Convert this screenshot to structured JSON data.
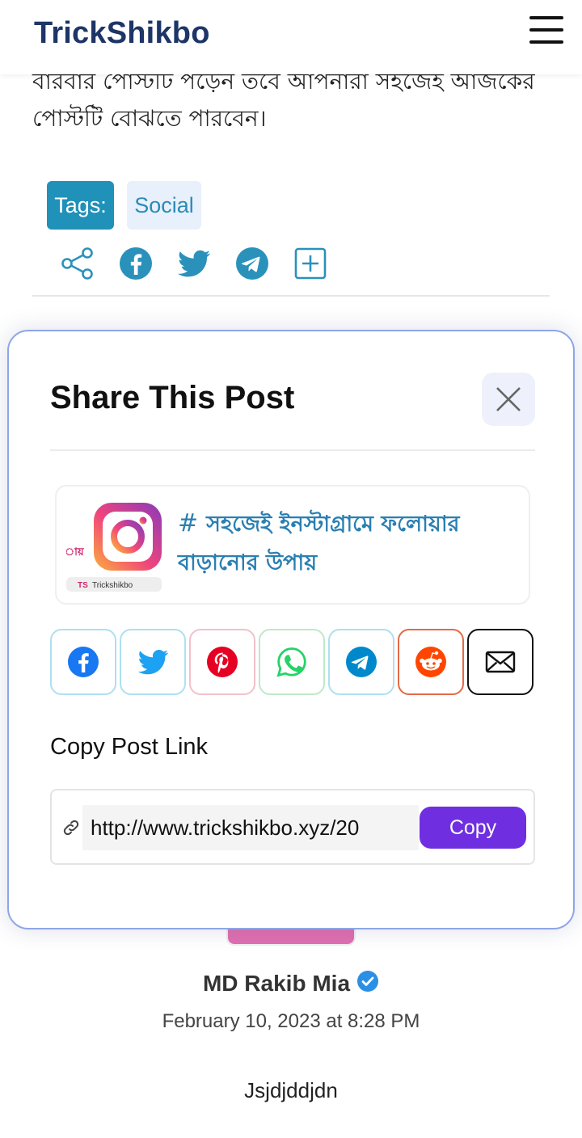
{
  "header": {
    "brand": "TrickShikbo",
    "menu_icon": "hamburger-menu-icon"
  },
  "article": {
    "text_line_1": "বারবার পোস্টটি পড়েন তবে আপনারা সহজেই আজকের",
    "text_line_2": "পোস্টটি বোঝতে পারবেন।"
  },
  "tags": {
    "label": "Tags:",
    "items": [
      "Social"
    ]
  },
  "share_icons": [
    "share-icon",
    "facebook-icon",
    "twitter-icon",
    "telegram-icon",
    "plus-square-icon"
  ],
  "modal": {
    "title": "Share This Post",
    "close_icon": "close-icon",
    "post": {
      "hash": "#",
      "title": "সহজেই ইনস্টাগ্রামে ফলোয়ার বাড়ানোর উপায়",
      "thumb_brand": "Trickshikbo",
      "thumb_ts": "TS",
      "thumb_side_text": "ায়"
    },
    "share_buttons": [
      {
        "name": "facebook",
        "color": "#1877f2"
      },
      {
        "name": "twitter",
        "color": "#1da1f2"
      },
      {
        "name": "pinterest",
        "color": "#e60023"
      },
      {
        "name": "whatsapp",
        "color": "#25d366"
      },
      {
        "name": "telegram",
        "color": "#0088cc"
      },
      {
        "name": "reddit",
        "color": "#ff4500"
      },
      {
        "name": "email",
        "color": "#111111"
      }
    ],
    "copy_label": "Copy Post Link",
    "link_value": "http://www.trickshikbo.xyz/20",
    "copy_button": "Copy"
  },
  "author": {
    "name": "MD Rakib Mia",
    "date": "February 10, 2023 at 8:28 PM",
    "comment": "Jsjdjddjdn"
  },
  "colors": {
    "brand": "#1d3567",
    "accent": "#2091b8",
    "copy_button": "#6f2fe0"
  }
}
